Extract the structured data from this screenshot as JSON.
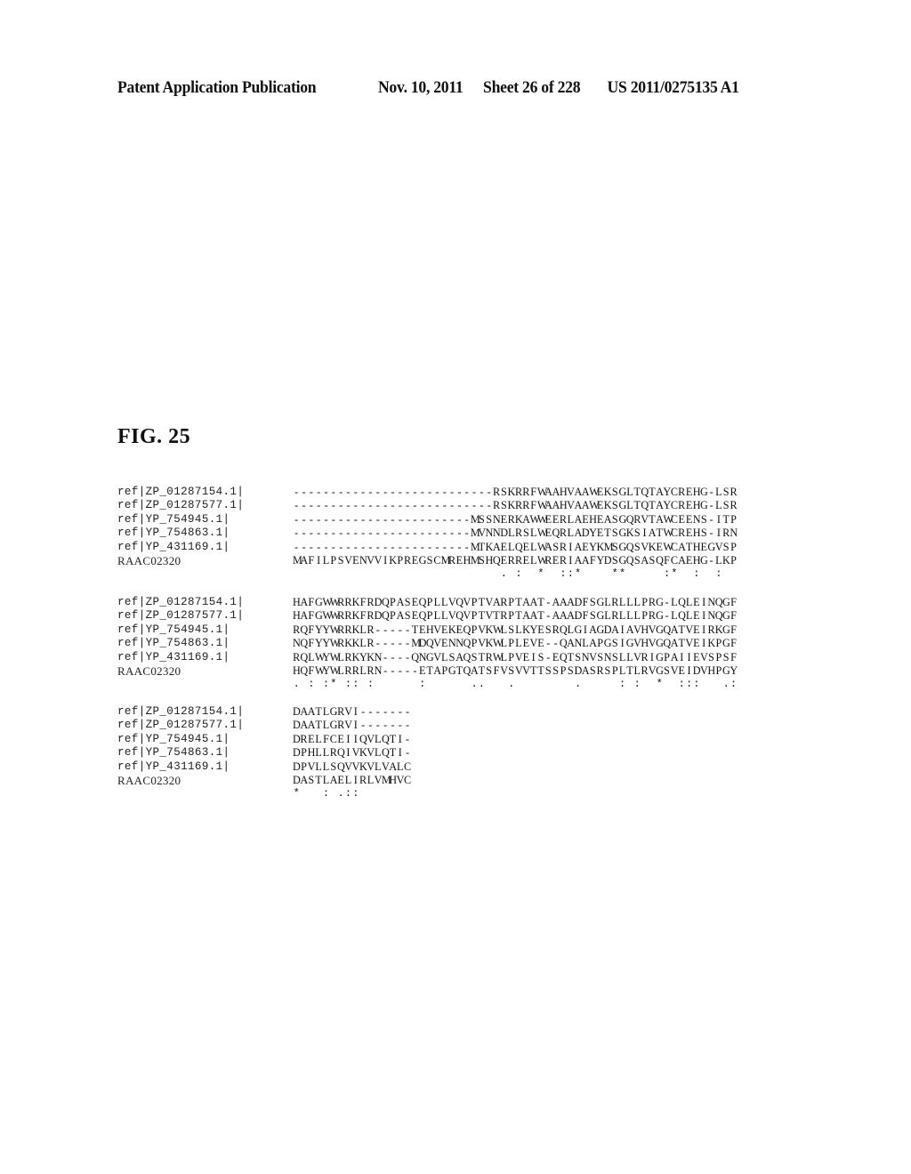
{
  "header": {
    "publication_type": "Patent Application Publication",
    "date": "Nov. 10, 2011",
    "sheet": "Sheet 26 of 228",
    "patent_number": "US 2011/0275135 A1"
  },
  "figure": {
    "title": "FIG. 25"
  },
  "alignment": {
    "blocks": [
      {
        "rows": [
          {
            "label": "ref|ZP_01287154.1|",
            "sequence": "---------------------------RSKRRFWAAHVAAWEKSGLTQTAYCREHG-LSR"
          },
          {
            "label": "ref|ZP_01287577.1|",
            "sequence": "---------------------------RSKRRFWAAHVAAWEKSGLTQTAYCREHG-LSR"
          },
          {
            "label": "ref|YP_754945.1|",
            "sequence": "------------------------MSSNERKAWWEERLAEHEASGQRVTAWCEENS-ITP"
          },
          {
            "label": "ref|YP_754863.1|",
            "sequence": "------------------------MVNNDLRSLWEQRLADYETSGKSIATWCREHS-IRN"
          },
          {
            "label": "ref|YP_431169.1|",
            "sequence": "------------------------MTKAELQELWASRIAEYKMSGQSVKEWCATHEGVSP"
          },
          {
            "label": "RAAC02320",
            "sequence": "MAFILPSVENVVIKPREGSCMREHMSHQERRELWRERIAAFYDSGQSASQFCAEHG-LKP"
          }
        ],
        "conservation": "                            . :  *  ::*    **     :*  :  :  "
      },
      {
        "rows": [
          {
            "label": "ref|ZP_01287154.1|",
            "sequence": "HAFGWWRRKFRDQPASEQPLLVQVPTVARPTAAT-AAADFSGLRLLLPRG-LQLEINQGF"
          },
          {
            "label": "ref|ZP_01287577.1|",
            "sequence": "HAFGWWRRKFRDQPASEQPLLVQVPTVTRPTAAT-AAADFSGLRLLLPRG-LQLEINQGF"
          },
          {
            "label": "ref|YP_754945.1|",
            "sequence": "RQFYYWRRKLR-----TEHVEKEQPVKWLSLKYESRQLGIAGDAIAVHVGQATVEIRKGF"
          },
          {
            "label": "ref|YP_754863.1|",
            "sequence": "NQFYYWRKKLR-----MDQVENNQPVKWLPLEVE--QANLAPGSIGVHVGQATVEIKPGF"
          },
          {
            "label": "ref|YP_431169.1|",
            "sequence": "RQLWYWLRKYKN----QNGVLSAQSTRWLPVEIS-EQTSNVSNSLLVRIGPAIIEVSPSF"
          },
          {
            "label": "RAAC02320",
            "sequence": "HQFWYWLRRLRN-----ETAPGTQATSFVSVVTTSSPSDASRSPLTLRVGSVEIDVHPGY"
          }
        ],
        "conservation": ". : :* :: :      :      ..   .        .     : :  *  :::   .:"
      },
      {
        "rows": [
          {
            "label": "ref|ZP_01287154.1|",
            "sequence": "DAATLGRVI-------"
          },
          {
            "label": "ref|ZP_01287577.1|",
            "sequence": "DAATLGRVI-------"
          },
          {
            "label": "ref|YP_754945.1|",
            "sequence": "DRELFCEIIQVLQTI-"
          },
          {
            "label": "ref|YP_754863.1|",
            "sequence": "DPHLLRQIVKVLQTI-"
          },
          {
            "label": "ref|YP_431169.1|",
            "sequence": "DPVLLSQVVKVLVALC"
          },
          {
            "label": "RAAC02320",
            "sequence": "DASTLAELIRLVMHVC"
          }
        ],
        "conservation": "*   : .::       "
      }
    ]
  }
}
